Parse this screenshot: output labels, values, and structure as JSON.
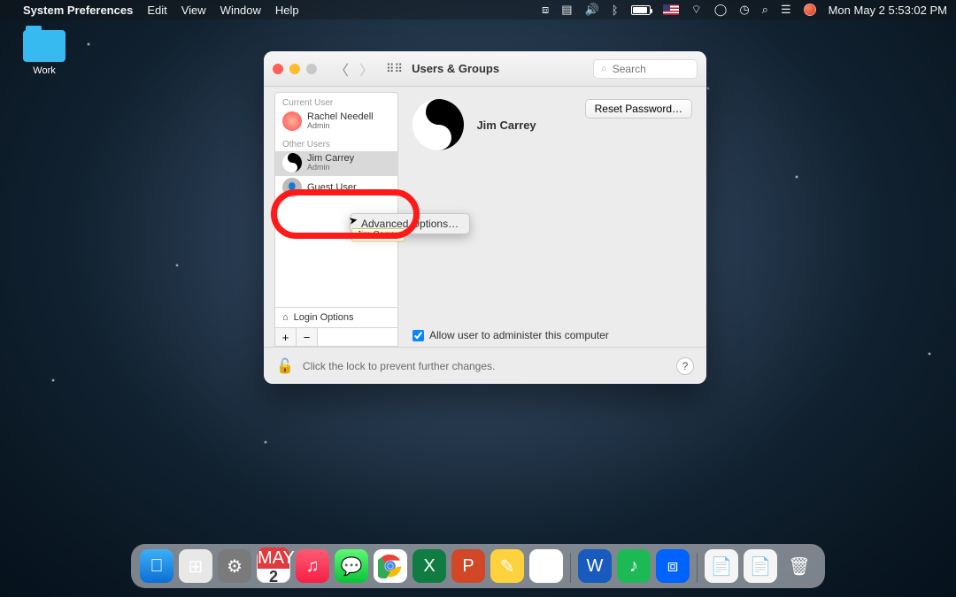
{
  "menubar": {
    "app": "System Preferences",
    "items": [
      "Edit",
      "View",
      "Window",
      "Help"
    ],
    "clock": "Mon May 2  5:53:02 PM"
  },
  "desktop": {
    "folder_label": "Work"
  },
  "window": {
    "title": "Users & Groups",
    "search_placeholder": "Search",
    "sections": {
      "current": "Current User",
      "other": "Other Users"
    },
    "users": {
      "current": {
        "name": "Rachel Needell",
        "role": "Admin"
      },
      "other": [
        {
          "name": "Jim Carrey",
          "role": "Admin"
        },
        {
          "name": "Guest User",
          "role": ""
        }
      ]
    },
    "login_options": "Login Options",
    "selected_user": "Jim Carrey",
    "reset_button": "Reset Password…",
    "allow_admin": "Allow user to administer this computer",
    "allow_admin_checked": true,
    "lock_text": "Click the lock to prevent further changes.",
    "help": "?"
  },
  "contextmenu": {
    "item": "Advanced Options…",
    "tooltip": "Jim Carrey"
  },
  "dock": {
    "calendar_month": "MAY",
    "calendar_day": "2"
  }
}
